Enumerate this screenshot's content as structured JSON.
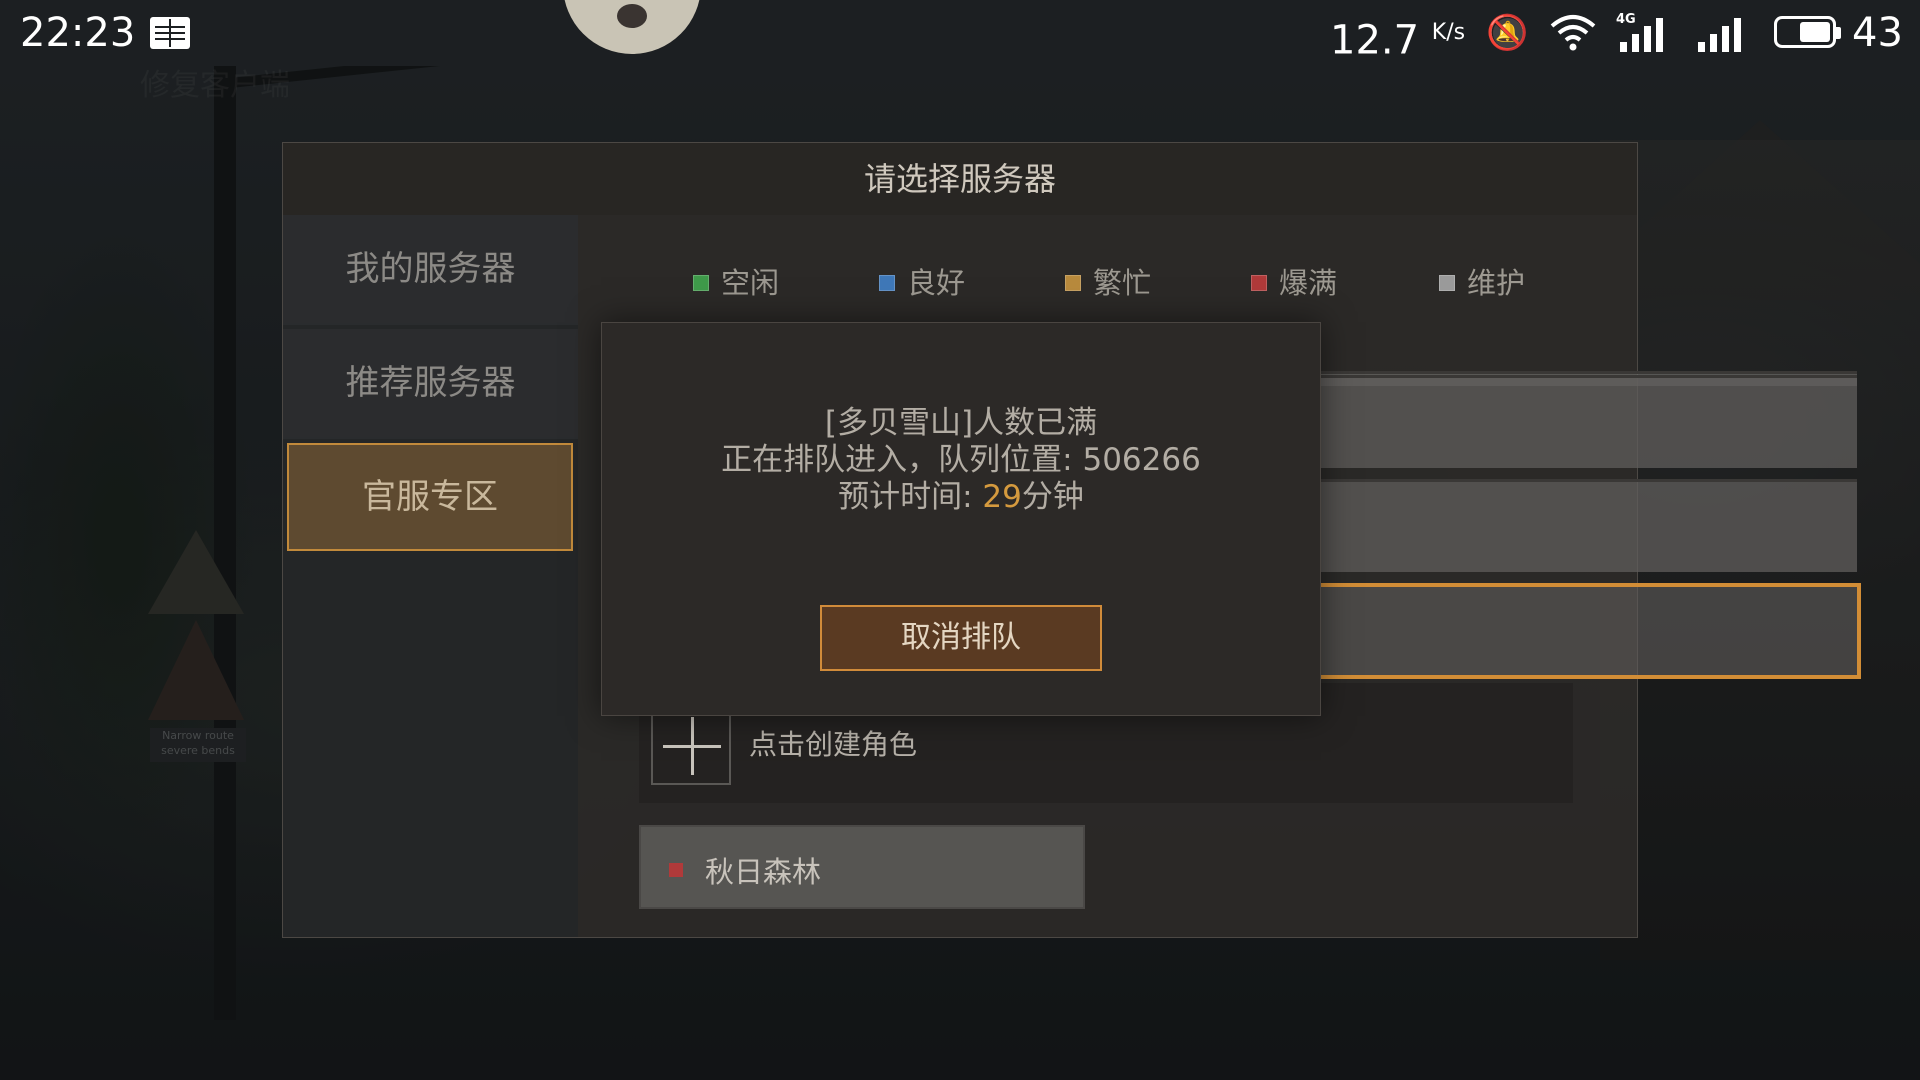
{
  "status_bar": {
    "time": "22:23",
    "net_speed": "12.7",
    "net_unit": "K/s",
    "network_type": "4G",
    "battery": "43",
    "icons": [
      "reader-icon",
      "mute-icon",
      "wifi-icon",
      "signal-icon",
      "signal-icon",
      "battery-icon"
    ]
  },
  "dialog": {
    "title": "请选择服务器",
    "tabs": [
      "我的服务器",
      "推荐服务器",
      "官服专区"
    ],
    "active_tab": "官服专区",
    "legend": [
      {
        "label": "空闲",
        "color": "#3f9a4a"
      },
      {
        "label": "良好",
        "color": "#3f78b8"
      },
      {
        "label": "繁忙",
        "color": "#b88a3d"
      },
      {
        "label": "爆满",
        "color": "#b03a3a"
      },
      {
        "label": "维护",
        "color": "#9a9a9a"
      }
    ],
    "create_role": "点击创建角色",
    "server_name": "秋日森林",
    "server_status_color": "#b03a3a"
  },
  "queue": {
    "line1": "[多贝雪山]人数已满",
    "line2_prefix": "正在排队进入，队列位置: ",
    "position": "506266",
    "line3_prefix": "预计时间: ",
    "minutes": "29",
    "line3_suffix": "分钟",
    "cancel_label": "取消排队"
  },
  "background": {
    "ghost_title": "修复客户端",
    "sign_text_1": "Narrow route",
    "sign_text_2": "severe bends"
  }
}
